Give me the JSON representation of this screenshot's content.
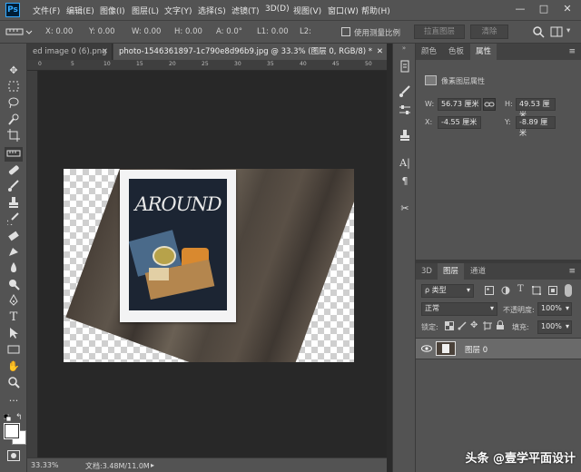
{
  "app": {
    "logo": "Ps"
  },
  "menu": [
    "文件(F)",
    "编辑(E)",
    "图像(I)",
    "图层(L)",
    "文字(Y)",
    "选择(S)",
    "滤镜(T)",
    "3D(D)",
    "视图(V)",
    "窗口(W)",
    "帮助(H)"
  ],
  "window_controls": [
    "—",
    "□",
    "✕"
  ],
  "options": {
    "x": "X: 0.00",
    "y": "Y: 0.00",
    "w": "W: 0.00",
    "h": "H: 0.00",
    "a": "A: 0.0°",
    "l1": "L1: 0.00",
    "l2": "L2:",
    "checkbox_label": "使用测量比例",
    "btn_straighten": "拉直图层",
    "btn_clear": "清除"
  },
  "tabs": [
    {
      "label": "ed image 0 (6).png",
      "close": "✕",
      "active": false
    },
    {
      "label": "photo-1546361897-1c790e8d96b9.jpg @ 33.3% (图层 0, RGB/8) *",
      "close": "✕",
      "active": true
    }
  ],
  "ruler_labels": [
    "0",
    "5",
    "10",
    "15",
    "20",
    "25",
    "30",
    "35",
    "40",
    "45",
    "50"
  ],
  "statusbar": {
    "zoom": "33.33%",
    "doc": "文档:3.48M/11.0M",
    "arrow": "▸"
  },
  "properties_panel": {
    "tabs": [
      "颜色",
      "色板",
      "属性"
    ],
    "section": "像素图层属性",
    "w_label": "W:",
    "w_value": "56.73 厘米",
    "h_label": "H:",
    "h_value": "49.53 厘米",
    "x_label": "X:",
    "x_value": "-4.55 厘米",
    "y_label": "Y:",
    "y_value": "-8.89 厘米"
  },
  "layers_panel": {
    "tabs": [
      "3D",
      "图层",
      "通道"
    ],
    "filter": "ρ 类型",
    "blend_mode": "正常",
    "opacity_label": "不透明度:",
    "opacity_value": "100%",
    "lock_label": "锁定:",
    "fill_label": "填充:",
    "fill_value": "100%",
    "layers": [
      {
        "name": "图层 0",
        "visible": true
      }
    ]
  },
  "artwork": {
    "title": "AROUND"
  },
  "watermark": "头条 @壹学平面设计"
}
